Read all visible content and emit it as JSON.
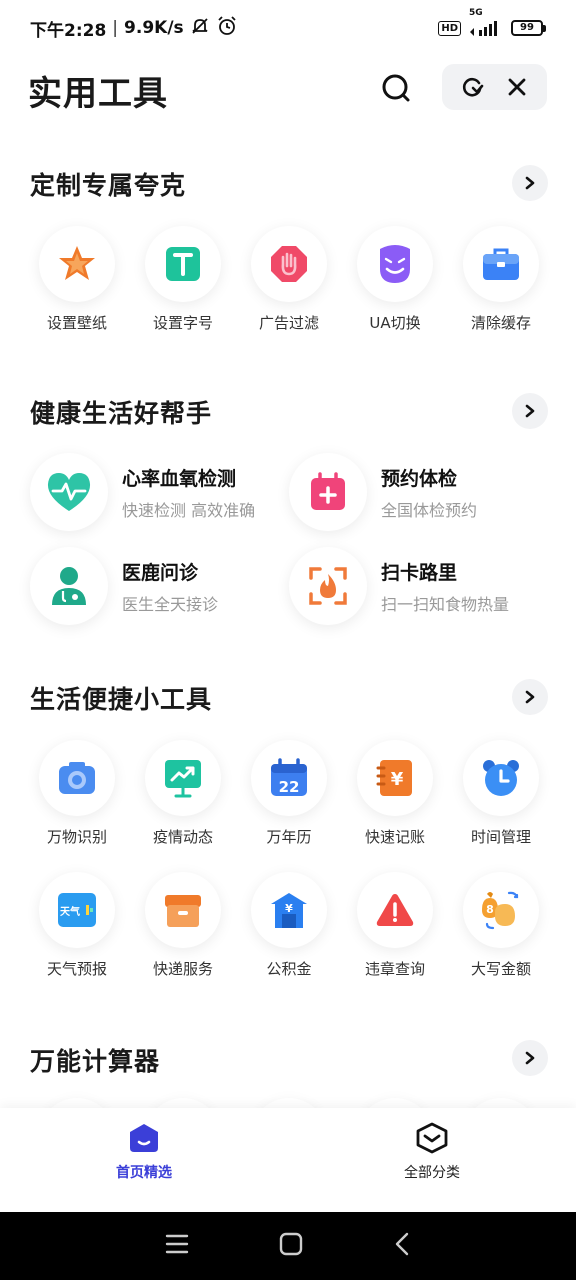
{
  "status_bar": {
    "time": "下午2:28",
    "speed": "9.9K/s",
    "hd": "HD",
    "network": "5G",
    "battery": "99"
  },
  "header": {
    "title": "实用工具"
  },
  "sections": {
    "custom": {
      "title": "定制专属夸克",
      "items": [
        {
          "label": "设置壁纸",
          "icon": "wallpaper-star-icon",
          "color": "#f07a2a"
        },
        {
          "label": "设置字号",
          "icon": "font-size-icon",
          "color": "#1ec39b"
        },
        {
          "label": "广告过滤",
          "icon": "ad-block-hand-icon",
          "color": "#f04a68"
        },
        {
          "label": "UA切换",
          "icon": "ua-switch-face-icon",
          "color": "#8b5cf6"
        },
        {
          "label": "清除缓存",
          "icon": "clear-cache-briefcase-icon",
          "color": "#3b82f6"
        }
      ]
    },
    "health": {
      "title": "健康生活好帮手",
      "items": [
        {
          "title": "心率血氧检测",
          "subtitle": "快速检测 高效准确",
          "icon": "heart-rate-icon",
          "color": "#2ec4a6"
        },
        {
          "title": "预约体检",
          "subtitle": "全国体检预约",
          "icon": "calendar-plus-icon",
          "color": "#f0447a"
        },
        {
          "title": "医鹿问诊",
          "subtitle": "医生全天接诊",
          "icon": "doctor-icon",
          "color": "#1fa98a"
        },
        {
          "title": "扫卡路里",
          "subtitle": "扫一扫知食物热量",
          "icon": "scan-flame-icon",
          "color": "#f07a3a"
        }
      ]
    },
    "life": {
      "title": "生活便捷小工具",
      "row1": [
        {
          "label": "万物识别",
          "icon": "camera-icon",
          "color": "#4a8cf0"
        },
        {
          "label": "疫情动态",
          "icon": "trend-monitor-icon",
          "color": "#1ec3a0"
        },
        {
          "label": "万年历",
          "icon": "calendar-22-icon",
          "color": "#3d7ff0",
          "badge": "22"
        },
        {
          "label": "快速记账",
          "icon": "ledger-yen-icon",
          "color": "#f07a2a",
          "badge": "¥"
        },
        {
          "label": "时间管理",
          "icon": "alarm-clock-icon",
          "color": "#3b8ff5"
        }
      ],
      "row2": [
        {
          "label": "天气预报",
          "icon": "weather-card-icon",
          "color": "#2a9cf0",
          "badge": "天气"
        },
        {
          "label": "快递服务",
          "icon": "parcel-box-icon",
          "color": "#f5a05a"
        },
        {
          "label": "公积金",
          "icon": "housing-fund-icon",
          "color": "#2a7ff0",
          "badge": "¥"
        },
        {
          "label": "违章查询",
          "icon": "warning-triangle-icon",
          "color": "#f04848"
        },
        {
          "label": "大写金额",
          "icon": "money-bag-icon",
          "color": "#f5a030",
          "badge": "8"
        }
      ]
    },
    "calculator": {
      "title": "万能计算器"
    }
  },
  "bottom_nav": {
    "home_label": "首页精选",
    "all_label": "全部分类",
    "active_color": "#3b3fd8"
  }
}
